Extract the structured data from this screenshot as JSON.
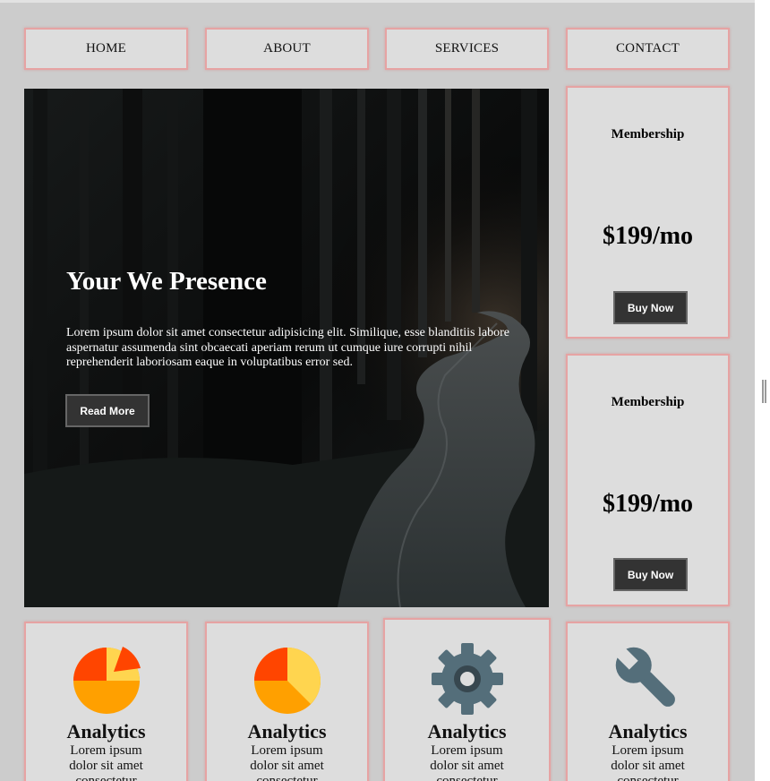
{
  "nav": {
    "items": [
      {
        "label": "HOME"
      },
      {
        "label": "ABOUT"
      },
      {
        "label": "SERVICES"
      },
      {
        "label": "CONTACT"
      }
    ]
  },
  "hero": {
    "title": "Your We Presence",
    "text": "Lorem ipsum dolor sit amet consectetur adipisicing elit. Similique, esse blanditiis labore aspernatur assumenda sint obcaecati aperiam rerum ut cumque iure corrupti nihil reprehenderit laboriosam eaque in voluptatibus error sed.",
    "button_label": "Read More"
  },
  "memberships": [
    {
      "title": "Membership",
      "price": "$199/mo",
      "button_label": "Buy Now"
    },
    {
      "title": "Membership",
      "price": "$199/mo",
      "button_label": "Buy Now"
    }
  ],
  "features": [
    {
      "icon": "pie-chart-icon",
      "title": "Analytics",
      "text": "Lorem ipsum dolor sit amet consectetur"
    },
    {
      "icon": "pie-chart-icon",
      "title": "Analytics",
      "text": "Lorem ipsum dolor sit amet consectetur"
    },
    {
      "icon": "gear-icon",
      "title": "Analytics",
      "text": "Lorem ipsum dolor sit amet consectetur"
    },
    {
      "icon": "wrench-icon",
      "title": "Analytics",
      "text": "Lorem ipsum dolor sit amet consectetur"
    }
  ],
  "colors": {
    "page_background": "#cccccc",
    "card_background": "#dddddd",
    "card_border": "#e6a3a3",
    "button_background": "#333333",
    "pie_orange": "#ffa000",
    "pie_red": "#ff4500",
    "pie_yellow": "#ffd54f",
    "icon_slate": "#546e7a"
  }
}
